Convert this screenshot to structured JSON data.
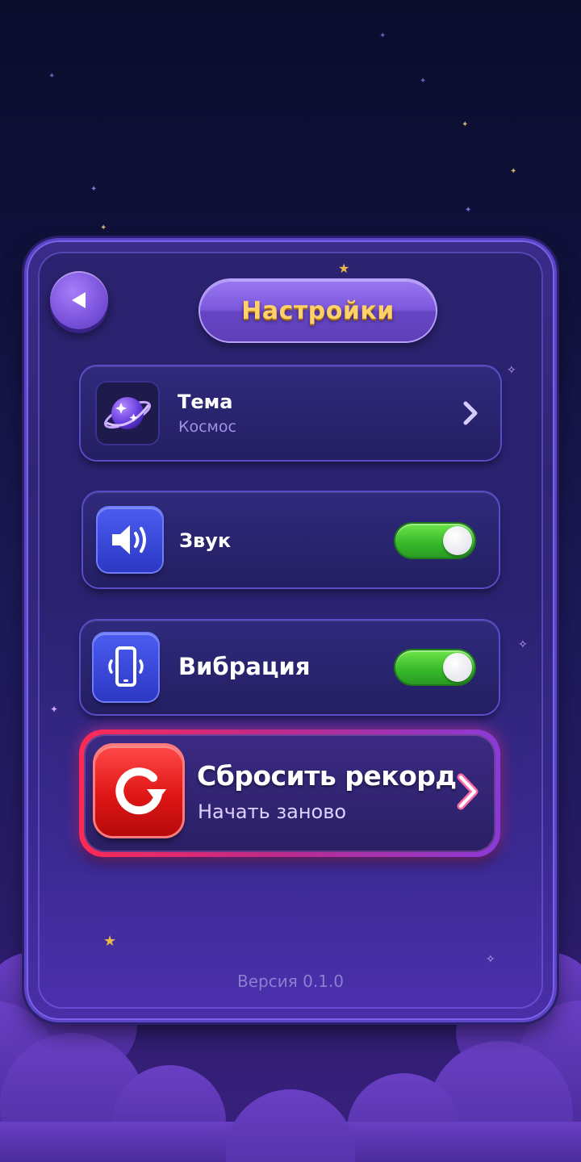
{
  "screen": {
    "title": "Настройки"
  },
  "theme_row": {
    "label": "Тема",
    "value": "Космос",
    "icon": "planet-icon"
  },
  "sound_row": {
    "label": "Звук",
    "icon": "speaker-icon",
    "enabled": true
  },
  "vibration_row": {
    "label": "Вибрация",
    "icon": "phone-vibrate-icon",
    "enabled": true
  },
  "reset_button": {
    "title": "Сбросить рекорд",
    "subtitle": "Начать заново",
    "icon": "restart-icon"
  },
  "footer": {
    "version": "Версия 0.1.0"
  },
  "colors": {
    "title_text": "#ffd166",
    "toggle_on": "#35b82a",
    "reset_accent": "#e01616",
    "panel": "#2b2370"
  }
}
